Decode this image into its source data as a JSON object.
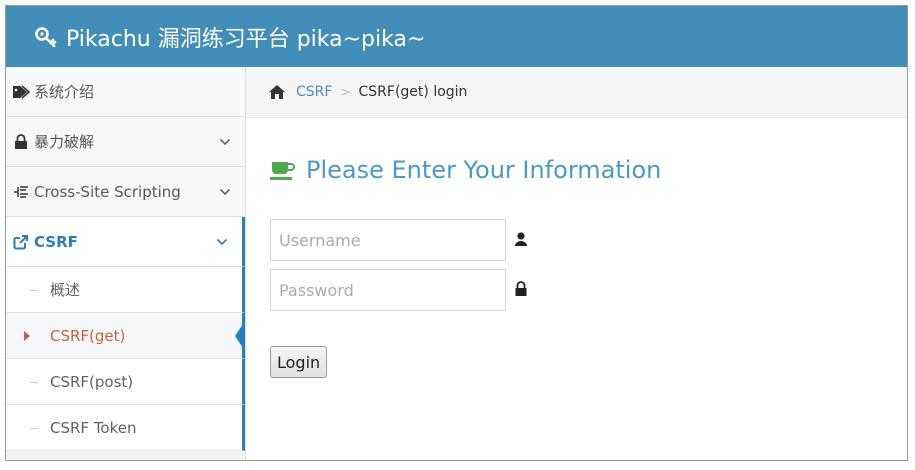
{
  "navbar": {
    "brand": "Pikachu 漏洞练习平台 pika~pika~",
    "brand_icon": "key-icon",
    "color": "#438eb9"
  },
  "sidebar": {
    "items": [
      {
        "label": "系统介绍",
        "icon": "tags-icon"
      },
      {
        "label": "暴力破解",
        "icon": "lock-icon"
      },
      {
        "label": "Cross-Site Scripting",
        "icon": "list-icon"
      },
      {
        "label": "CSRF",
        "icon": "external-link-icon"
      }
    ],
    "subitems": [
      {
        "label": "概述"
      },
      {
        "label": "CSRF(get)"
      },
      {
        "label": "CSRF(post)"
      },
      {
        "label": "CSRF Token"
      }
    ]
  },
  "breadcrumb": {
    "link": "CSRF",
    "separator": ">",
    "current": "CSRF(get) login"
  },
  "main": {
    "heading": "Please Enter Your Information",
    "username_placeholder": "Username",
    "password_placeholder": "Password",
    "login_label": "Login"
  },
  "colors": {
    "accent": "#2b7dbc",
    "heading": "#4a9ac6",
    "active_sub": "#c86139"
  }
}
